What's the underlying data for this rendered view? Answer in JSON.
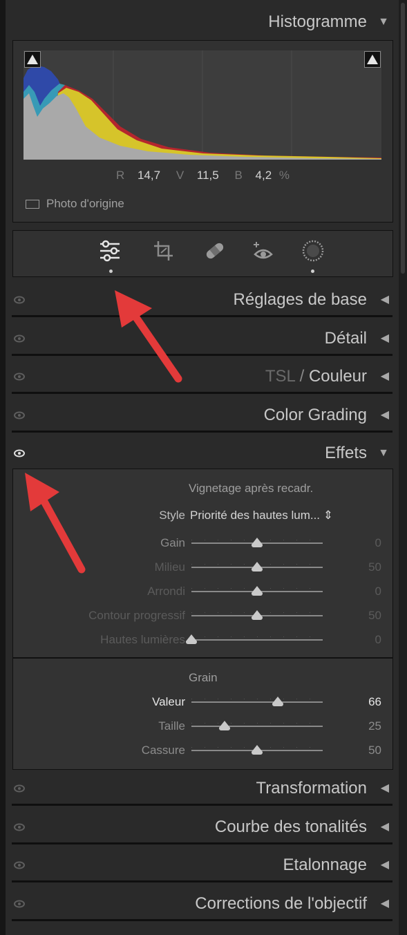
{
  "histogram": {
    "title": "Histogramme",
    "r_label": "R",
    "r_value": "14,7",
    "g_label": "V",
    "g_value": "11,5",
    "b_label": "B",
    "b_value": "4,2",
    "unit": "%",
    "original_label": "Photo d'origine"
  },
  "tools": [
    {
      "name": "edit-sliders-icon",
      "active": true
    },
    {
      "name": "crop-icon",
      "active": false
    },
    {
      "name": "healing-icon",
      "active": false
    },
    {
      "name": "red-eye-icon",
      "active": false
    },
    {
      "name": "masking-icon",
      "active": false
    }
  ],
  "panels": {
    "reglages": "Réglages de base",
    "detail": "Détail",
    "tsl_part1": "TSL",
    "tsl_sep": "/",
    "tsl_part2": "Couleur",
    "color_grading": "Color Grading",
    "effets": "Effets",
    "transformation": "Transformation",
    "courbe": "Courbe des tonalités",
    "etalonnage": "Etalonnage",
    "corrections": "Corrections de l'objectif"
  },
  "vignette": {
    "title": "Vignetage après recadr.",
    "style_label": "Style",
    "style_value": "Priorité des hautes lum... ⇕",
    "sliders": [
      {
        "label": "Gain",
        "value": "0",
        "level": 0.5
      },
      {
        "label": "Milieu",
        "value": "50",
        "level": 0.5
      },
      {
        "label": "Arrondi",
        "value": "0",
        "level": 0.5
      },
      {
        "label": "Contour progressif",
        "value": "50",
        "level": 0.5
      },
      {
        "label": "Hautes lumières",
        "value": "0",
        "level": 0.0
      }
    ]
  },
  "grain": {
    "title": "Grain",
    "sliders": [
      {
        "label": "Valeur",
        "value": "66",
        "level": 0.66
      },
      {
        "label": "Taille",
        "value": "25",
        "level": 0.25
      },
      {
        "label": "Cassure",
        "value": "50",
        "level": 0.5
      }
    ]
  },
  "colors": {
    "panel_bg": "#2a2a2a",
    "annotation_arrow": "#e33a3a"
  }
}
